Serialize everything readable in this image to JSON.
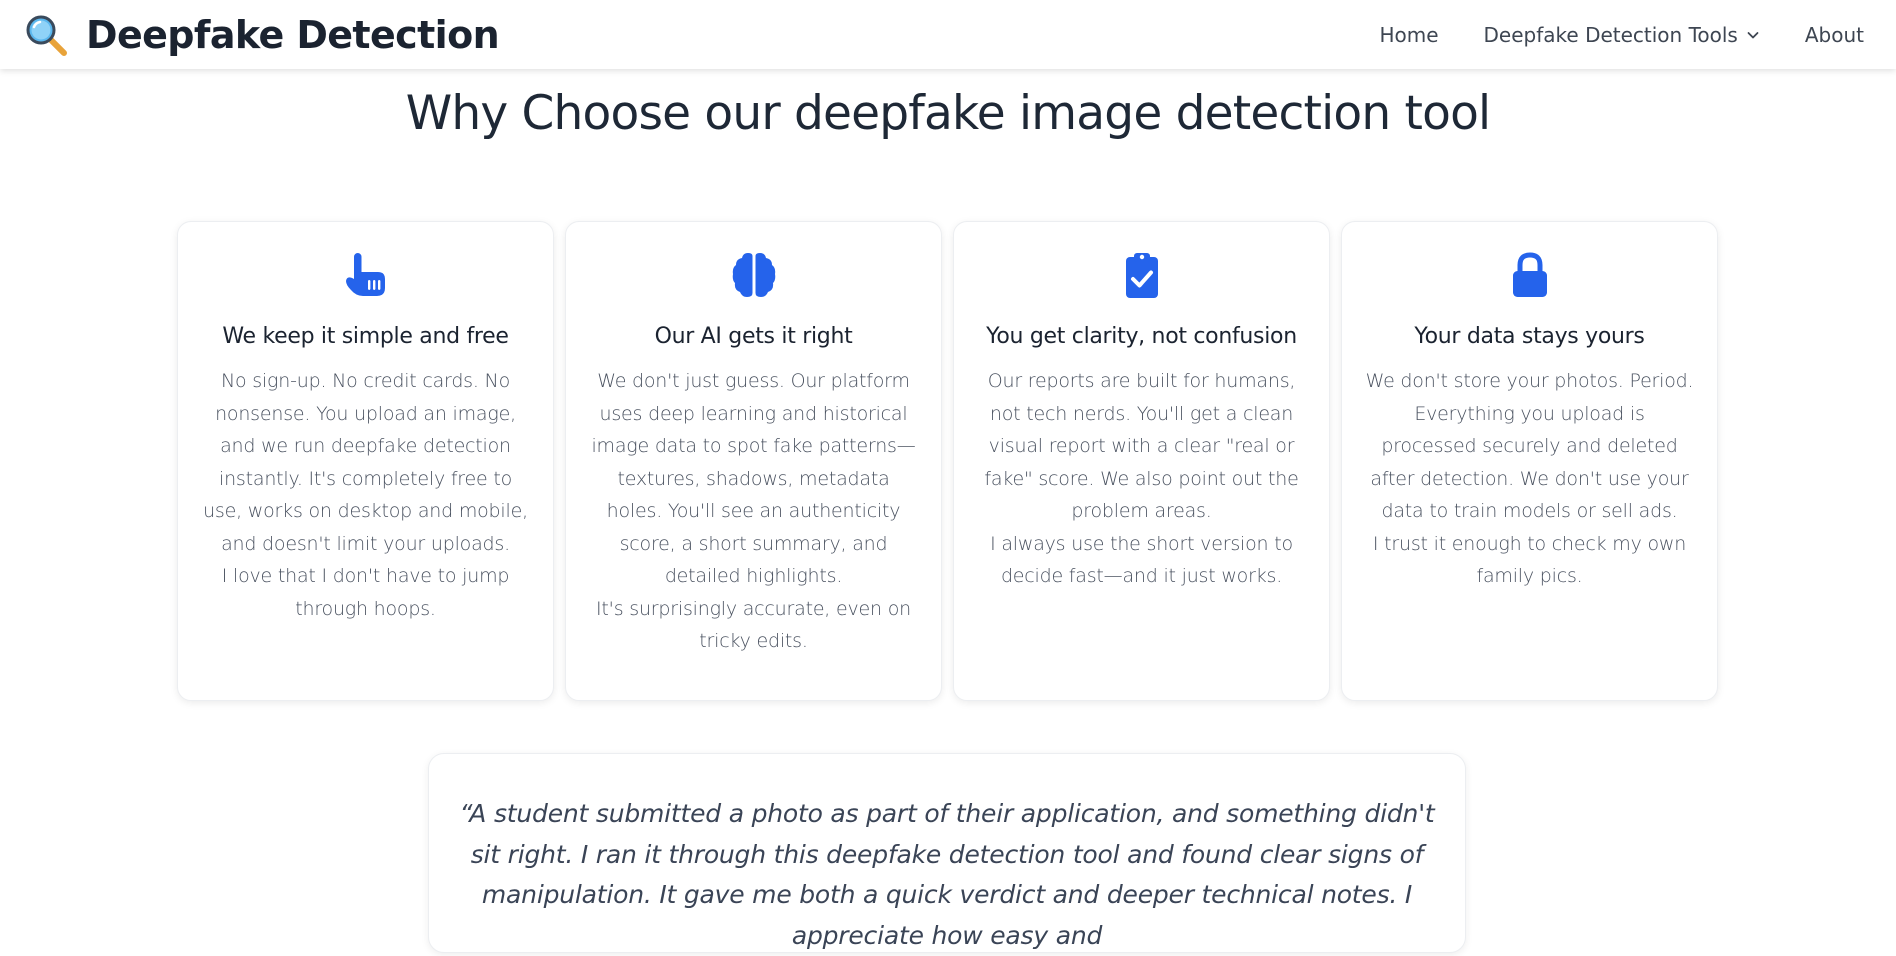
{
  "header": {
    "brand_title": "Deepfake Detection",
    "brand_icon": "magnifying-glass-icon",
    "nav": [
      {
        "label": "Home"
      },
      {
        "label": "Deepfake Detection Tools",
        "dropdown": true
      },
      {
        "label": "About"
      }
    ]
  },
  "section": {
    "title": "Why Choose our deepfake image detection tool"
  },
  "cards": [
    {
      "icon": "pointing-hand-icon",
      "title": "We keep it simple and free",
      "paragraphs": [
        "No sign-up. No credit cards. No nonsense. You upload an image, and we run deepfake detection instantly. It's completely free to use, works on desktop and mobile, and doesn't limit your uploads.",
        "I love that I don't have to jump through hoops."
      ]
    },
    {
      "icon": "brain-icon",
      "title": "Our AI gets it right",
      "paragraphs": [
        "We don't just guess. Our platform uses deep learning and historical image data to spot fake patterns—textures, shadows, metadata holes. You'll see an authenticity score, a short summary, and detailed highlights.",
        "It's surprisingly accurate, even on tricky edits."
      ]
    },
    {
      "icon": "clipboard-check-icon",
      "title": "You get clarity, not confusion",
      "paragraphs": [
        "Our reports are built for humans, not tech nerds. You'll get a clean visual report with a clear \"real or fake\" score. We also point out the problem areas.",
        "I always use the short version to decide fast—and it just works."
      ]
    },
    {
      "icon": "lock-icon",
      "title": "Your data stays yours",
      "paragraphs": [
        "We don't store your photos. Period. Everything you upload is processed securely and deleted after detection. We don't use your data to train models or sell ads.",
        "I trust it enough to check my own family pics."
      ]
    }
  ],
  "testimonial": {
    "quote": "“A student submitted a photo as part of their application, and something didn't sit right. I ran it through this deepfake detection tool and found clear signs of manipulation. It gave me both a quick verdict and deeper technical notes. I appreciate how easy and"
  },
  "colors": {
    "accent": "#2563eb",
    "text_dark": "#1b2330",
    "text_body": "#4a5260"
  }
}
